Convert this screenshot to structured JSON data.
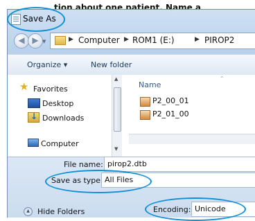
{
  "caption": "tion about one patient. Name a",
  "window": {
    "title": "Save As"
  },
  "address_bar": {
    "crumbs": [
      "Computer",
      "ROM1 (E:)",
      "PIROP2"
    ]
  },
  "toolbar": {
    "organize": "Organize ▾",
    "new_folder": "New folder"
  },
  "nav_pane": {
    "favorites": "Favorites",
    "desktop": "Desktop",
    "downloads": "Downloads",
    "computer": "Computer"
  },
  "file_list": {
    "column_name": "Name",
    "files": [
      "P2_00_01",
      "P2_01_00"
    ]
  },
  "form": {
    "file_name_label": "File name:",
    "file_name_value": "pirop2.dtb",
    "save_type_label": "Save as type:",
    "save_type_value": "All Files",
    "encoding_label": "Encoding:",
    "encoding_value": "Unicode",
    "hide_folders": "Hide Folders"
  },
  "colors": {
    "highlight_ellipse": "#0d90d6"
  },
  "icons": [
    "window-icon",
    "back-icon",
    "forward-icon",
    "folder-icon",
    "star-icon",
    "desktop-icon",
    "downloads-icon",
    "computer-icon",
    "file-icon",
    "collapse-icon"
  ]
}
